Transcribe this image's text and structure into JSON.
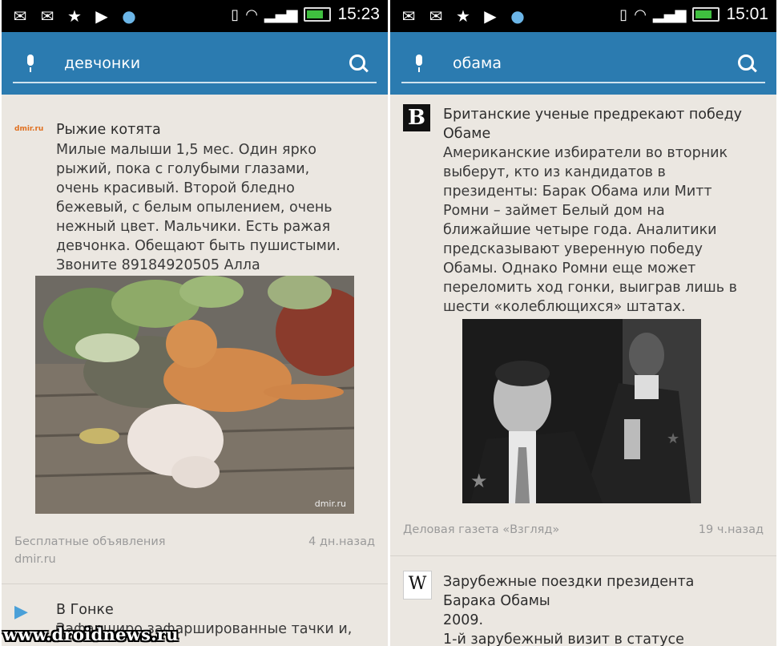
{
  "left": {
    "status": {
      "time": "15:23"
    },
    "search": {
      "query": "девчонки"
    },
    "result1": {
      "source_logo": "dmir.ru",
      "title": "Рыжие котята",
      "body": "Милые малыши 1,5 мес. Один ярко\nрыжий, пока с голубыми глазами,\nочень красивый. Второй бледно\nбежевый, с белым опылением, очень\nнежный цвет. Мальчики. Есть ражая\nдевчонка. Обещают быть пушистыми.\nЗвоните 89184920505 Алла",
      "image_caption": "dmir.ru",
      "source_name": "Бесплатные объявления",
      "source_domain": "dmir.ru",
      "age": "4 дн.назад"
    },
    "result2": {
      "title": "В Гонке",
      "body": "Зафарширо  зафаршированные тачки и,"
    }
  },
  "right": {
    "status": {
      "time": "15:01"
    },
    "search": {
      "query": "обама"
    },
    "result1": {
      "source_logo": "B",
      "title": "Британские ученые предрекают победу\nОбаме",
      "body": "Американские избиратели во вторник\nвыберут, кто из кандидатов в\nпрезиденты: Барак Обама или Митт\nРомни – займет Белый дом на\nближайшие четыре года. Аналитики\nпредсказывают уверенную победу\nОбамы. Однако Ромни еще может\nпереломить ход гонки, выиграв лишь в\nшести «колеблющихся» штатах.",
      "source_name": "Деловая газета «Взгляд»",
      "age": "19 ч.назад"
    },
    "result2": {
      "source_logo": "W",
      "title": "Зарубежные поездки президента\nБарака Обамы\n2009.\n1-й зарубежный визит в статусе"
    }
  },
  "watermark": "www.droidnews.ru",
  "colors": {
    "search_bar": "#2b7bb0",
    "background": "#ebe7e1",
    "status_bar": "#000000"
  }
}
